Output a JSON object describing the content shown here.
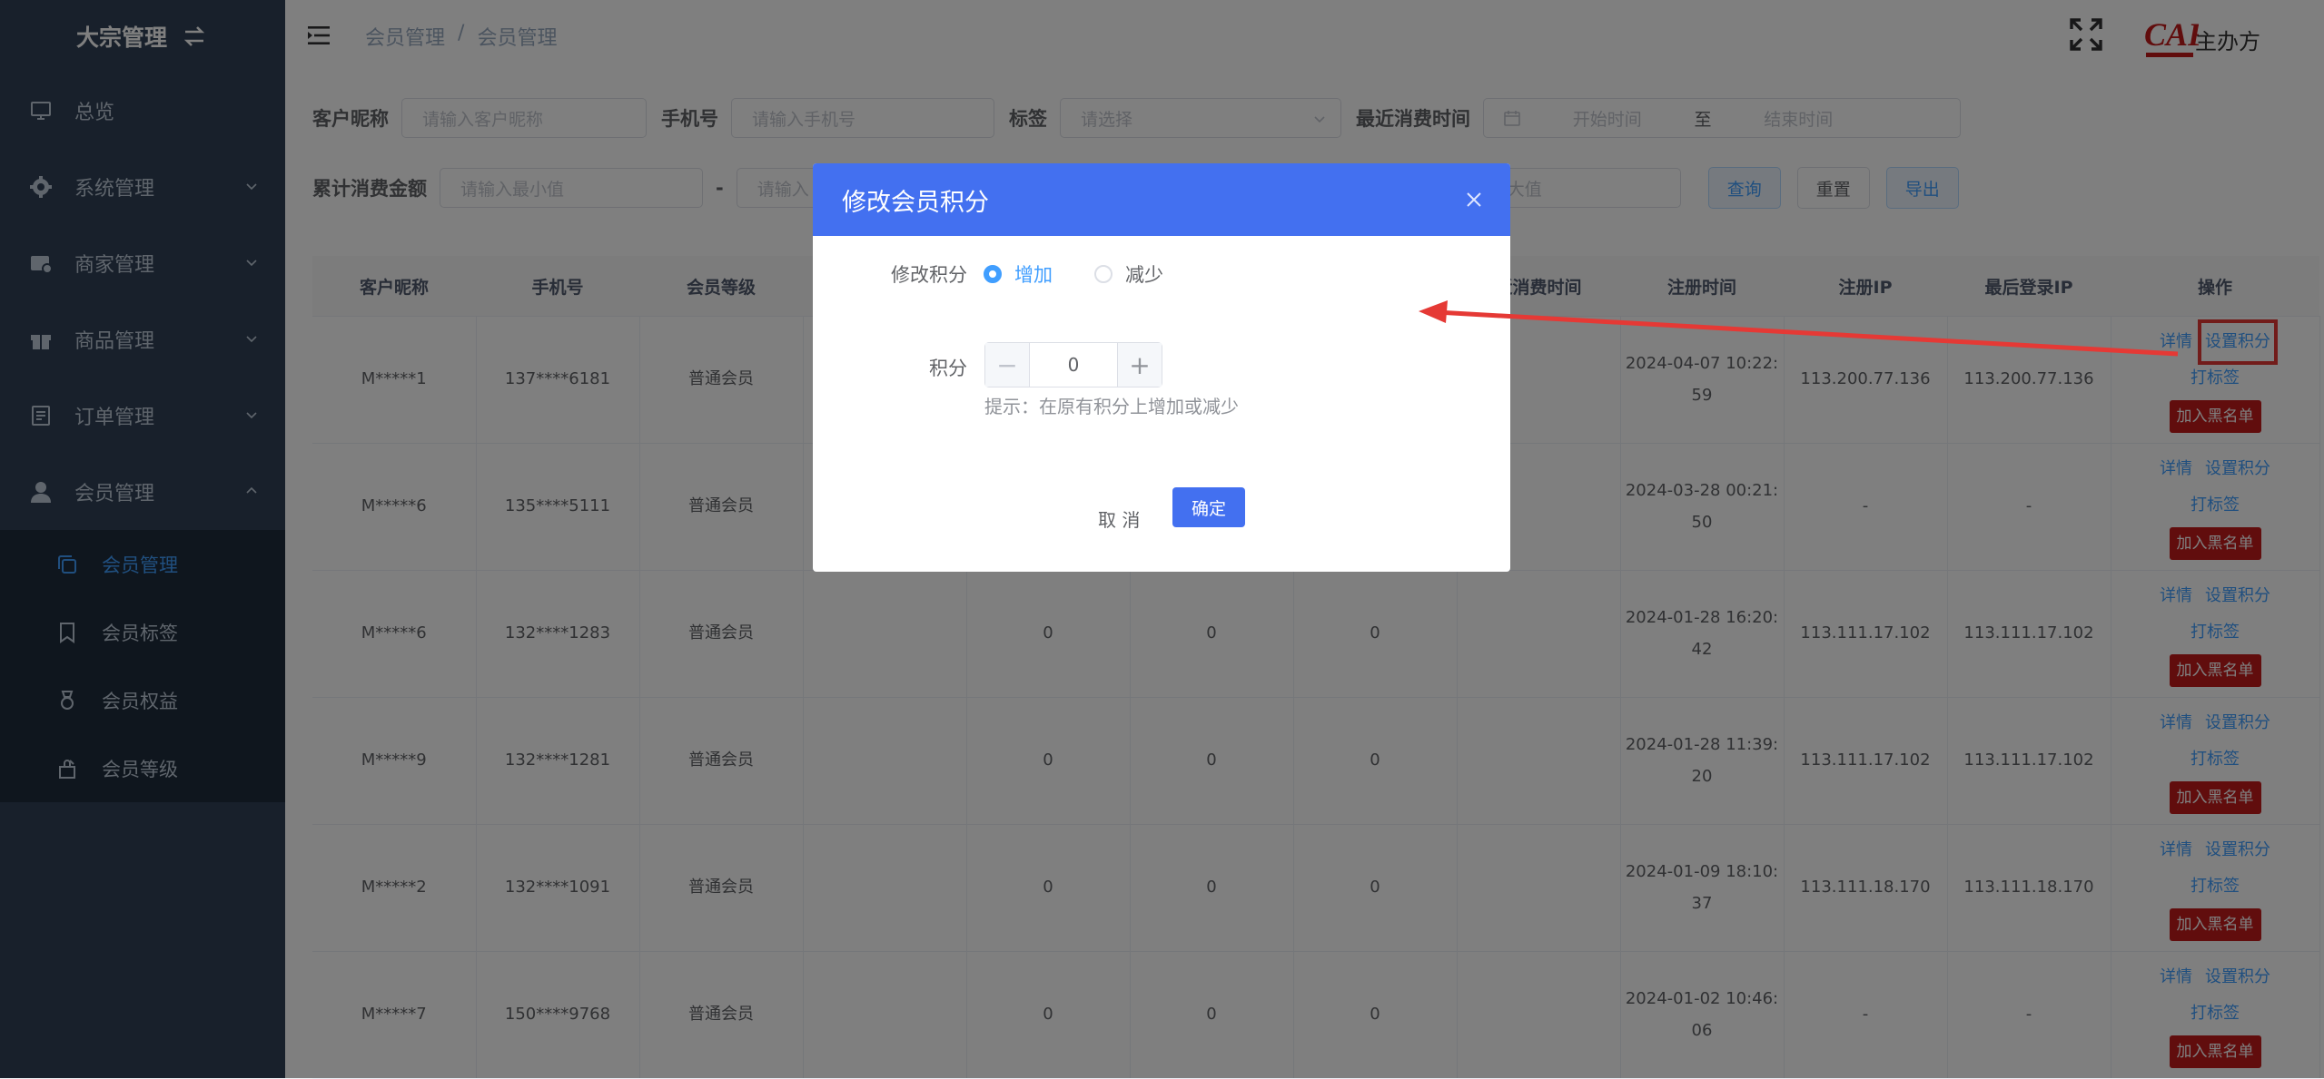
{
  "sidebar": {
    "brand": "大宗管理",
    "items": [
      {
        "label": "总览",
        "icon": "monitor-icon"
      },
      {
        "label": "系统管理",
        "icon": "gear-icon"
      },
      {
        "label": "商家管理",
        "icon": "store-icon"
      },
      {
        "label": "商品管理",
        "icon": "gift-icon"
      },
      {
        "label": "订单管理",
        "icon": "order-icon"
      },
      {
        "label": "会员管理",
        "icon": "user-icon"
      }
    ],
    "sub_items": [
      {
        "label": "会员管理",
        "icon": "copy-icon"
      },
      {
        "label": "会员标签",
        "icon": "bookmark-icon"
      },
      {
        "label": "会员权益",
        "icon": "medal-icon"
      },
      {
        "label": "会员等级",
        "icon": "level-icon"
      }
    ]
  },
  "header": {
    "breadcrumb": [
      "会员管理",
      "/",
      "会员管理"
    ],
    "logo_text": "CAF",
    "org_name": "主办方"
  },
  "filters": {
    "nickname_label": "客户昵称",
    "nickname_placeholder": "请输入客户昵称",
    "phone_label": "手机号",
    "phone_placeholder": "请输入手机号",
    "tag_label": "标签",
    "tag_placeholder": "请选择",
    "recent_label": "最近消费时间",
    "start_placeholder": "开始时间",
    "range_sep": "至",
    "end_placeholder": "结束时间",
    "amount_label": "累计消费金额",
    "min_placeholder": "请输入最小值",
    "dash": "-",
    "max_placeholder_left": "请输入",
    "max_placeholder_right": "大值",
    "query": "查询",
    "reset": "重置",
    "export": "导出"
  },
  "table": {
    "columns": [
      "客户昵称",
      "手机号",
      "会员等级",
      "",
      "",
      "",
      "",
      "近消费时间",
      "注册时间",
      "注册IP",
      "最后登录IP",
      "操作"
    ],
    "rows": [
      {
        "nick": "M*****1",
        "phone": "137****6181",
        "level": "普通会员",
        "a": "",
        "b": "",
        "c": "",
        "reg_date": "2024-04-07 10:22:",
        "reg_sec": "59",
        "reg_ip": "113.200.77.136",
        "last_ip": "113.200.77.136"
      },
      {
        "nick": "M*****6",
        "phone": "135****5111",
        "level": "普通会员",
        "a": "",
        "b": "",
        "c": "",
        "reg_date": "2024-03-28 00:21:",
        "reg_sec": "50",
        "reg_ip": "-",
        "last_ip": "-"
      },
      {
        "nick": "M*****6",
        "phone": "132****1283",
        "level": "普通会员",
        "a": "0",
        "b": "0",
        "c": "0",
        "reg_date": "2024-01-28 16:20:",
        "reg_sec": "42",
        "reg_ip": "113.111.17.102",
        "last_ip": "113.111.17.102"
      },
      {
        "nick": "M*****9",
        "phone": "132****1281",
        "level": "普通会员",
        "a": "0",
        "b": "0",
        "c": "0",
        "reg_date": "2024-01-28 11:39:",
        "reg_sec": "20",
        "reg_ip": "113.111.17.102",
        "last_ip": "113.111.17.102"
      },
      {
        "nick": "M*****2",
        "phone": "132****1091",
        "level": "普通会员",
        "a": "0",
        "b": "0",
        "c": "0",
        "reg_date": "2024-01-09 18:10:",
        "reg_sec": "37",
        "reg_ip": "113.111.18.170",
        "last_ip": "113.111.18.170"
      },
      {
        "nick": "M*****7",
        "phone": "150****9768",
        "level": "普通会员",
        "a": "0",
        "b": "0",
        "c": "0",
        "reg_date": "2024-01-02 10:46:",
        "reg_sec": "06",
        "reg_ip": "-",
        "last_ip": "-"
      }
    ],
    "ops": {
      "detail": "详情",
      "set_points": "设置积分",
      "tag": "打标签",
      "blacklist": "加入黑名单"
    }
  },
  "dialog": {
    "title": "修改会员积分",
    "mode_label": "修改积分",
    "increase": "增加",
    "decrease": "减少",
    "points_label": "积分",
    "points_value": "0",
    "hint": "提示：在原有积分上增加或减少",
    "cancel": "取 消",
    "confirm": "确定"
  },
  "colors": {
    "sidebar": "#304156",
    "accent": "#409eff",
    "dialog_header": "#4370f0",
    "annotation": "#e53935"
  }
}
